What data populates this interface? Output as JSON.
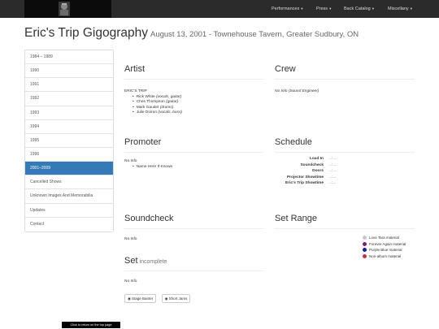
{
  "navbar": {
    "menus": [
      "Performances",
      "Press",
      "Back Catalog",
      "Miscellany"
    ],
    "caret": "▾",
    "logo_icon": "band-logo-icon"
  },
  "header": {
    "title": "Eric's Trip Gigography",
    "subtitle": "August 13, 2001 - Townehouse Tavern, Greater Sudbury, ON"
  },
  "sidebar": {
    "items": [
      {
        "label": "1984 – 1989",
        "active": false
      },
      {
        "label": "1990",
        "active": false
      },
      {
        "label": "1991",
        "active": false
      },
      {
        "label": "1992",
        "active": false
      },
      {
        "label": "1993",
        "active": false
      },
      {
        "label": "1994",
        "active": false
      },
      {
        "label": "1995",
        "active": false
      },
      {
        "label": "1996",
        "active": false
      },
      {
        "label": "2001–2009",
        "active": true
      },
      {
        "label": "Cancelled Shows",
        "active": false
      },
      {
        "label": "Unknown Images And Memorabilia",
        "active": false
      },
      {
        "label": "Updates",
        "active": false
      },
      {
        "label": "Contact",
        "active": false
      }
    ]
  },
  "artist": {
    "heading": "Artist",
    "name": "ERIC'S TRIP",
    "members": [
      {
        "name": "Rick White",
        "role": "(vocals, guitar)"
      },
      {
        "name": "Chris Thompson",
        "role": "(guitar)"
      },
      {
        "name": "Mark Gaudet",
        "role": "(drums)"
      },
      {
        "name": "Julie Doiron",
        "role": "(vocals, bass)"
      }
    ]
  },
  "crew": {
    "heading": "Crew",
    "text": "No Info (Sound Engineer)"
  },
  "promoter": {
    "heading": "Promoter",
    "no_info": "No Info",
    "item": "Name Here If Known"
  },
  "schedule": {
    "heading": "Schedule",
    "rows": [
      {
        "label": "Load In",
        "value": "...:..."
      },
      {
        "label": "Soundcheck",
        "value": "...:..."
      },
      {
        "label": "Doors",
        "value": "...:..."
      },
      {
        "label": "Projector Showtime",
        "value": "...:..."
      },
      {
        "label": "Eric's Trip Showtime",
        "value": "...:..."
      }
    ]
  },
  "soundcheck": {
    "heading": "Soundcheck",
    "text": "No Info"
  },
  "set_range": {
    "heading": "Set Range",
    "legend": [
      {
        "label": "Love Tara material",
        "color": "#c8c8c8"
      },
      {
        "label": "Forever Again material",
        "color": "#7a1f7a"
      },
      {
        "label": "Purple Blue material",
        "color": "#1a1aa8"
      },
      {
        "label": "Non-album material",
        "color": "#c0304a"
      }
    ]
  },
  "set": {
    "heading": "Set",
    "status": "incomplete",
    "text": "No Info",
    "buttons": [
      {
        "label": "Stage Banter",
        "icon": "eye-icon"
      },
      {
        "label": "Short Jams",
        "icon": "eye-icon"
      }
    ]
  },
  "footer": {
    "back_to_top": "Click to return on the top page"
  }
}
